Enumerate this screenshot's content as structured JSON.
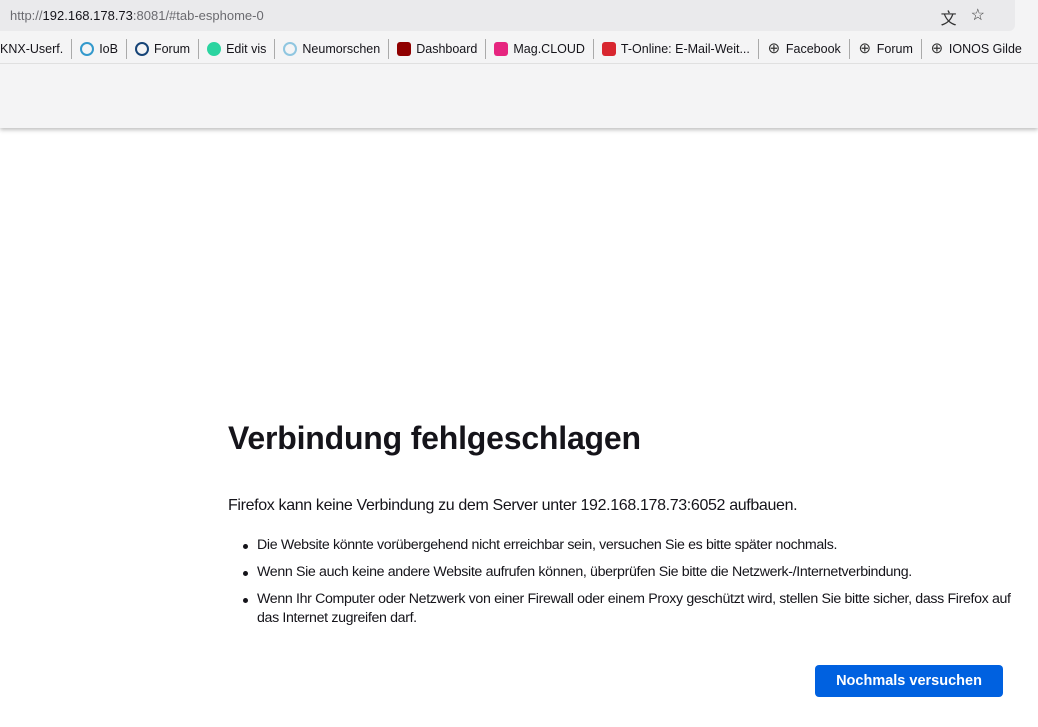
{
  "browser": {
    "url": {
      "scheme": "http://",
      "host": "192.168.178.73",
      "rest": ":8081/#tab-esphome-0"
    },
    "bookmarks": [
      {
        "label": "KNX-Userf.",
        "icon": "none",
        "color": ""
      },
      {
        "label": "IoB",
        "icon": "iobroker-icon",
        "color": "#3399cc"
      },
      {
        "label": "Forum",
        "icon": "iobroker-icon",
        "color": "#164477"
      },
      {
        "label": "Edit vis",
        "icon": "vis-icon",
        "color": "#2bd4a0"
      },
      {
        "label": "Neumorschen",
        "icon": "gauge-icon",
        "color": "#8fc6e0"
      },
      {
        "label": "Dashboard",
        "icon": "nodered-icon",
        "color": "#8f0000"
      },
      {
        "label": "Mag.CLOUD",
        "icon": "cloud-icon",
        "color": "#e6257f"
      },
      {
        "label": "T-Online: E-Mail-Weit...",
        "icon": "tonline-icon",
        "color": "#d8262f"
      },
      {
        "label": "Facebook",
        "icon": "globe-icon",
        "color": ""
      },
      {
        "label": "Forum",
        "icon": "globe-icon",
        "color": ""
      },
      {
        "label": "IONOS Gilde",
        "icon": "globe-icon",
        "color": ""
      }
    ]
  },
  "error": {
    "title": "Verbindung fehlgeschlagen",
    "description": "Firefox kann keine Verbindung zu dem Server unter 192.168.178.73:6052 aufbauen.",
    "bullets": [
      "Die Website könnte vorübergehend nicht erreichbar sein, versuchen Sie es bitte später nochmals.",
      "Wenn Sie auch keine andere Website aufrufen können, überprüfen Sie bitte die Netzwerk-/Internetverbindung.",
      "Wenn Ihr Computer oder Netzwerk von einer Firewall oder einem Proxy geschützt wird, stellen Sie bitte sicher, dass Firefox auf das Internet zugreifen darf."
    ],
    "retry_label": "Nochmals versuchen"
  }
}
